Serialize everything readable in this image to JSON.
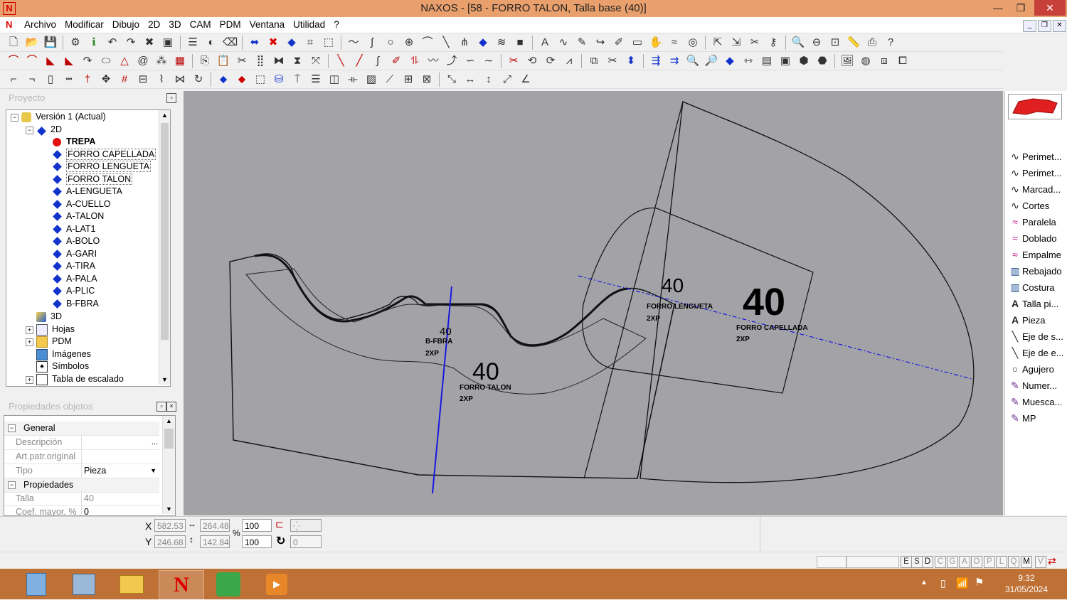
{
  "window": {
    "title": "NAXOS - [58 - FORRO TALON, Talla base (40)]"
  },
  "menu": [
    "Archivo",
    "Modificar",
    "Dibujo",
    "2D",
    "3D",
    "CAM",
    "PDM",
    "Ventana",
    "Utilidad",
    "?"
  ],
  "project_panel": {
    "title": "Proyecto",
    "tree": [
      {
        "label": "Versión 1 (Actual)",
        "level": 0,
        "icon": "version-icon"
      },
      {
        "label": "2D",
        "level": 1,
        "icon": "2d-folder-icon"
      },
      {
        "label": "TREPA",
        "level": 2,
        "icon": "red-dot-icon",
        "bold": true
      },
      {
        "label": "FORRO CAPELLADA",
        "level": 2,
        "icon": "piece-diamond-icon",
        "boxed": true
      },
      {
        "label": "FORRO LENGUETA",
        "level": 2,
        "icon": "piece-diamond-icon",
        "boxed": true
      },
      {
        "label": "FORRO TALON",
        "level": 2,
        "icon": "piece-diamond-icon",
        "boxed": true
      },
      {
        "label": "A-LENGUETA",
        "level": 2,
        "icon": "piece-diamond-icon"
      },
      {
        "label": "A-CUELLO",
        "level": 2,
        "icon": "piece-diamond-icon"
      },
      {
        "label": "A-TALON",
        "level": 2,
        "icon": "piece-diamond-icon"
      },
      {
        "label": "A-LAT1",
        "level": 2,
        "icon": "piece-diamond-icon"
      },
      {
        "label": "A-BOLO",
        "level": 2,
        "icon": "piece-diamond-icon"
      },
      {
        "label": "A-GARI",
        "level": 2,
        "icon": "piece-diamond-icon"
      },
      {
        "label": "A-TIRA",
        "level": 2,
        "icon": "piece-diamond-icon"
      },
      {
        "label": "A-PALA",
        "level": 2,
        "icon": "piece-diamond-icon"
      },
      {
        "label": "A-PLIC",
        "level": 2,
        "icon": "piece-diamond-icon"
      },
      {
        "label": "B-FBRA",
        "level": 2,
        "icon": "piece-diamond-icon"
      },
      {
        "label": "3D",
        "level": 1,
        "icon": "3d-icon"
      },
      {
        "label": "Hojas",
        "level": 1,
        "icon": "sheets-icon"
      },
      {
        "label": "PDM",
        "level": 1,
        "icon": "folder-icon"
      },
      {
        "label": "Imágenes",
        "level": 1,
        "icon": "images-icon"
      },
      {
        "label": "Símbolos",
        "level": 1,
        "icon": "symbols-icon"
      },
      {
        "label": "Tabla de escalado",
        "level": 1,
        "icon": "scaling-table-icon"
      }
    ]
  },
  "properties_panel": {
    "title": "Propiedades objetos",
    "rows": [
      {
        "type": "category",
        "label": "General"
      },
      {
        "type": "field",
        "label": "Descripción",
        "value": ""
      },
      {
        "type": "field",
        "label": "Art.patr.original",
        "value": ""
      },
      {
        "type": "field",
        "label": "Tipo",
        "value": "Pieza"
      },
      {
        "type": "category",
        "label": "Propiedades"
      },
      {
        "type": "field",
        "label": "Talla",
        "value": "40"
      },
      {
        "type": "field",
        "label": "Coef. mayor. %",
        "value": "0"
      }
    ]
  },
  "canvas": {
    "labels": [
      {
        "size": "40",
        "name": "B-FBRA",
        "qty": "2XP"
      },
      {
        "size": "40",
        "name": "FORRO TALON",
        "qty": "2XP"
      },
      {
        "size": "40",
        "name": "FORRO LENGUETA",
        "qty": "2XP"
      },
      {
        "size": "40",
        "name": "FORRO CAPELLADA",
        "qty": "2XP"
      }
    ]
  },
  "right_panel": {
    "items": [
      {
        "label": "Perimet...",
        "icon": "curve-icon"
      },
      {
        "label": "Perimet...",
        "icon": "curve-icon"
      },
      {
        "label": "Marcad...",
        "icon": "curve-icon"
      },
      {
        "label": "Cortes",
        "icon": "curve-icon"
      },
      {
        "label": "Paralela",
        "icon": "parallel-icon"
      },
      {
        "label": "Doblado",
        "icon": "fold-icon"
      },
      {
        "label": "Empalme",
        "icon": "join-icon"
      },
      {
        "label": "Rebajado",
        "icon": "skiving-icon"
      },
      {
        "label": "Costura",
        "icon": "seam-icon"
      },
      {
        "label": "Talla pi...",
        "icon": "text-a-icon"
      },
      {
        "label": "Pieza",
        "icon": "text-a-icon"
      },
      {
        "label": "Eje de s...",
        "icon": "axis-icon"
      },
      {
        "label": "Eje de e...",
        "icon": "axis-icon"
      },
      {
        "label": "Agujero",
        "icon": "hole-icon"
      },
      {
        "label": "Numer...",
        "icon": "pen-icon"
      },
      {
        "label": "Muesca...",
        "icon": "pen-icon"
      },
      {
        "label": "MP",
        "icon": "pen-icon"
      }
    ]
  },
  "coords": {
    "x": "582.53",
    "y": "246.68",
    "width": "264.48",
    "height": "142.84",
    "scale_x": "100",
    "scale_y": "100",
    "rotation": "0",
    "x_label": "X",
    "y_label": "Y",
    "percent": "%"
  },
  "snap_keys": [
    "E",
    "S",
    "D",
    "C",
    "G",
    "A",
    "O",
    "P",
    "L",
    "Q",
    "M",
    "V"
  ],
  "taskbar": {
    "time": "9:32",
    "date": "31/05/2024"
  }
}
